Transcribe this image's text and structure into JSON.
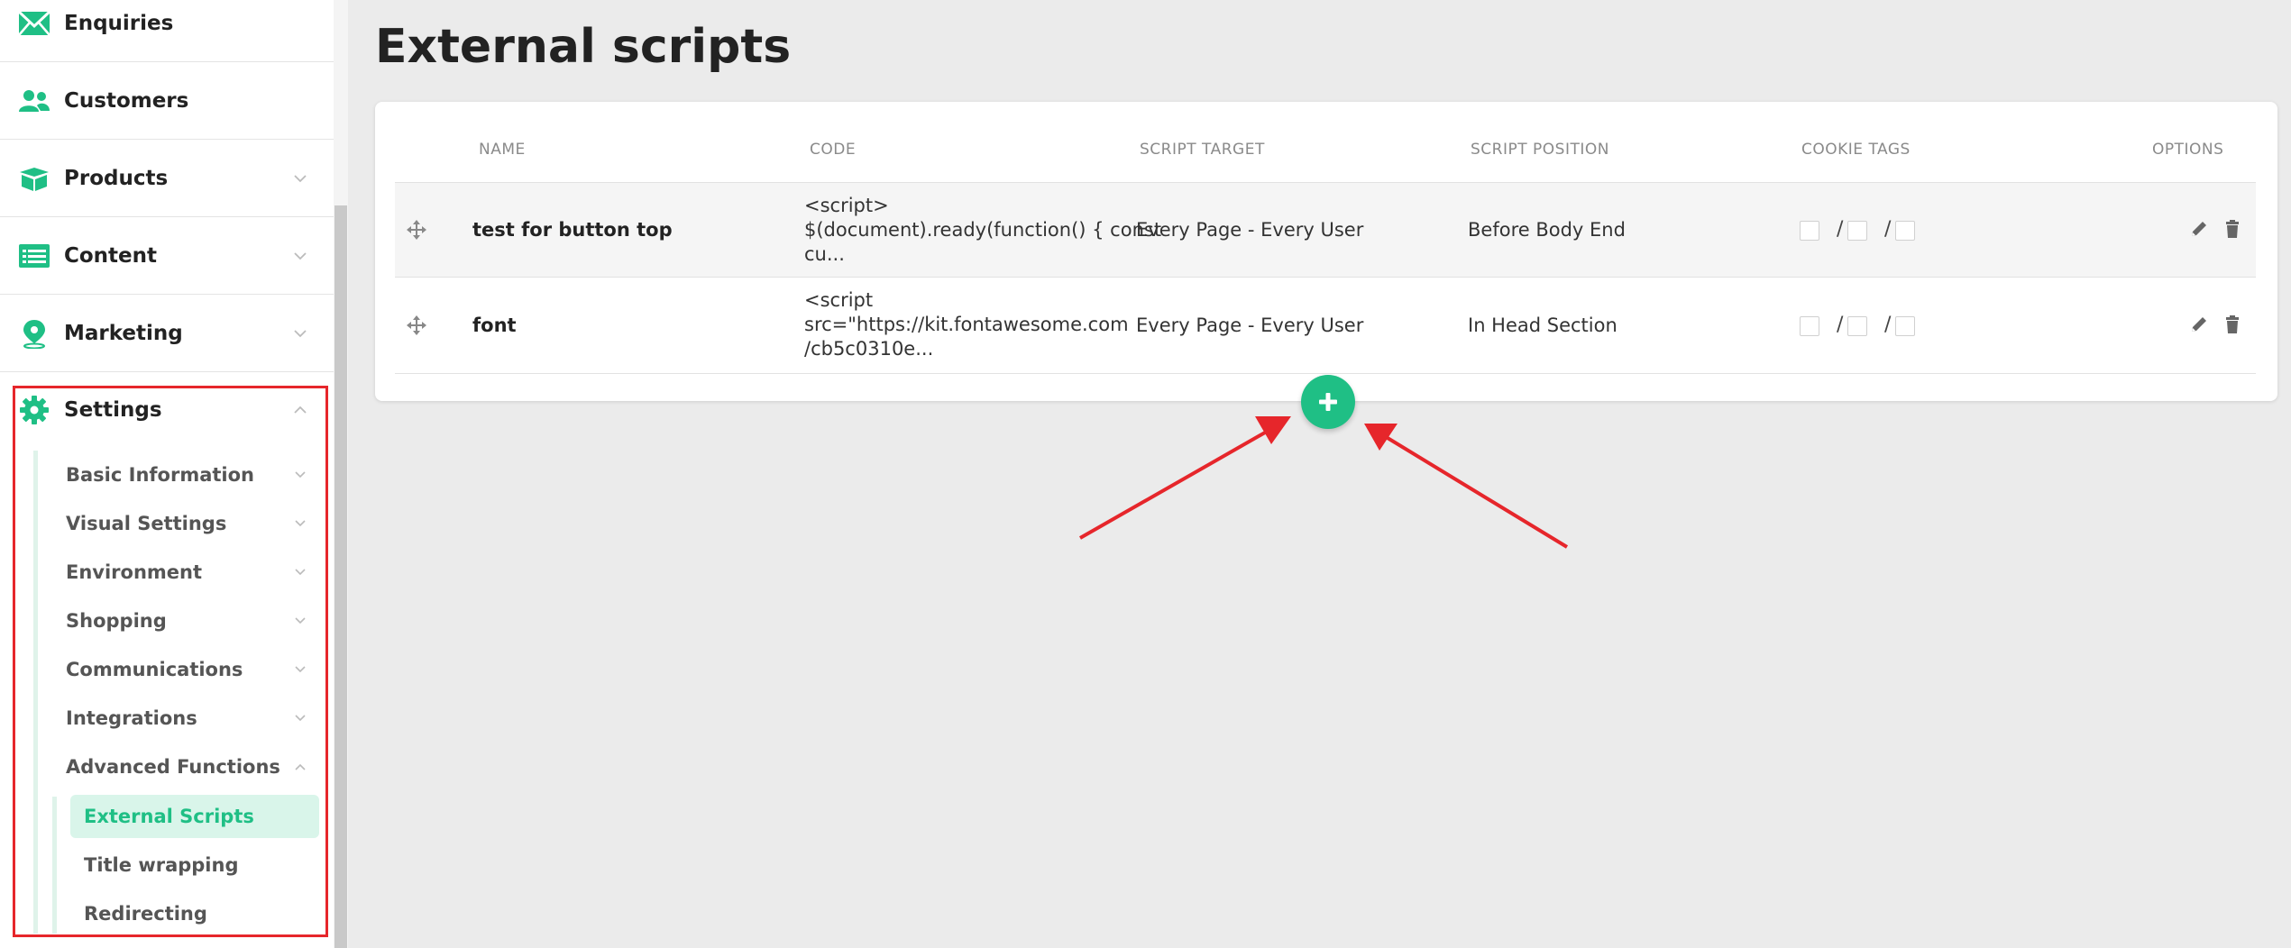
{
  "sidebar": {
    "items": [
      {
        "label": "Enquiries",
        "icon": "envelope-icon"
      },
      {
        "label": "Customers",
        "icon": "users-icon"
      },
      {
        "label": "Products",
        "icon": "box-icon"
      },
      {
        "label": "Content",
        "icon": "list-icon"
      },
      {
        "label": "Marketing",
        "icon": "map-pin-icon"
      },
      {
        "label": "Settings",
        "icon": "gear-icon"
      }
    ],
    "settings_items": [
      {
        "label": "Basic Information"
      },
      {
        "label": "Visual Settings"
      },
      {
        "label": "Environment"
      },
      {
        "label": "Shopping"
      },
      {
        "label": "Communications"
      },
      {
        "label": "Integrations"
      },
      {
        "label": "Advanced Functions"
      }
    ],
    "advanced_items": [
      {
        "label": "External Scripts",
        "active": true
      },
      {
        "label": "Title wrapping"
      },
      {
        "label": "Redirecting"
      }
    ]
  },
  "main": {
    "title": "External scripts",
    "table": {
      "columns": [
        "NAME",
        "CODE",
        "SCRIPT TARGET",
        "SCRIPT POSITION",
        "COOKIE TAGS",
        "OPTIONS"
      ],
      "rows": [
        {
          "name": "test for button top",
          "code": [
            "<script>",
            "$(document).ready(function() { const",
            "cu..."
          ],
          "target": "Every Page - Every User",
          "position": "Before Body End"
        },
        {
          "name": "font",
          "code": [
            "<script",
            "src=\"https://kit.fontawesome.com",
            "/cb5c0310e..."
          ],
          "target": "Every Page - Every User",
          "position": "In Head Section"
        }
      ],
      "separator": "/"
    }
  },
  "colors": {
    "accent": "#1fbf85",
    "highlight": "#e6262b"
  }
}
